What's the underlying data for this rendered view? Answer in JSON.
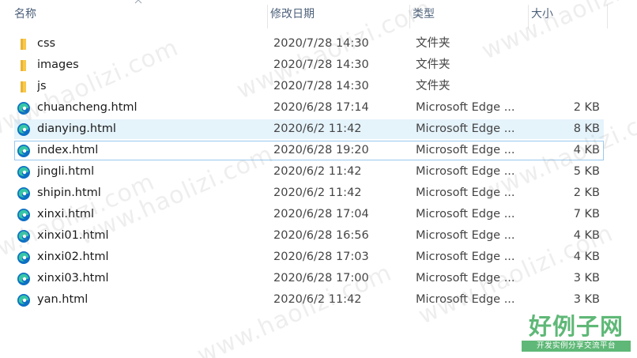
{
  "columns": {
    "name": "名称",
    "date": "修改日期",
    "type": "类型",
    "size": "大小"
  },
  "files": [
    {
      "name": "css",
      "date": "2020/7/28 14:30",
      "type": "文件夹",
      "size": "",
      "icon": "folder-icon",
      "state": "normal"
    },
    {
      "name": "images",
      "date": "2020/7/28 14:30",
      "type": "文件夹",
      "size": "",
      "icon": "folder-icon",
      "state": "normal"
    },
    {
      "name": "js",
      "date": "2020/7/28 14:30",
      "type": "文件夹",
      "size": "",
      "icon": "folder-icon",
      "state": "normal"
    },
    {
      "name": "chuancheng.html",
      "date": "2020/6/28 17:14",
      "type": "Microsoft Edge ...",
      "size": "2 KB",
      "icon": "edge-icon",
      "state": "normal"
    },
    {
      "name": "dianying.html",
      "date": "2020/6/2 11:42",
      "type": "Microsoft Edge ...",
      "size": "8 KB",
      "icon": "edge-icon",
      "state": "hover"
    },
    {
      "name": "index.html",
      "date": "2020/6/28 19:20",
      "type": "Microsoft Edge ...",
      "size": "4 KB",
      "icon": "edge-icon",
      "state": "focus"
    },
    {
      "name": "jingli.html",
      "date": "2020/6/2 11:42",
      "type": "Microsoft Edge ...",
      "size": "5 KB",
      "icon": "edge-icon",
      "state": "normal"
    },
    {
      "name": "shipin.html",
      "date": "2020/6/2 11:42",
      "type": "Microsoft Edge ...",
      "size": "2 KB",
      "icon": "edge-icon",
      "state": "normal"
    },
    {
      "name": "xinxi.html",
      "date": "2020/6/28 17:04",
      "type": "Microsoft Edge ...",
      "size": "7 KB",
      "icon": "edge-icon",
      "state": "normal"
    },
    {
      "name": "xinxi01.html",
      "date": "2020/6/28 16:56",
      "type": "Microsoft Edge ...",
      "size": "4 KB",
      "icon": "edge-icon",
      "state": "normal"
    },
    {
      "name": "xinxi02.html",
      "date": "2020/6/28 17:03",
      "type": "Microsoft Edge ...",
      "size": "4 KB",
      "icon": "edge-icon",
      "state": "normal"
    },
    {
      "name": "xinxi03.html",
      "date": "2020/6/28 17:00",
      "type": "Microsoft Edge ...",
      "size": "3 KB",
      "icon": "edge-icon",
      "state": "normal"
    },
    {
      "name": "yan.html",
      "date": "2020/6/2 11:42",
      "type": "Microsoft Edge ...",
      "size": "3 KB",
      "icon": "edge-icon",
      "state": "normal"
    }
  ],
  "watermark": {
    "text": "www.haolizi.com",
    "brand": "好例子网",
    "tagline": "开发实例分享交流平台"
  },
  "colors": {
    "folder": "#f8c94a",
    "edge_blue": "#0c6fc4",
    "edge_teal": "#36c6a6",
    "hover_bg": "#e5f3fb",
    "focus_border": "#99c9ef",
    "brand_green": "#5fb877"
  }
}
